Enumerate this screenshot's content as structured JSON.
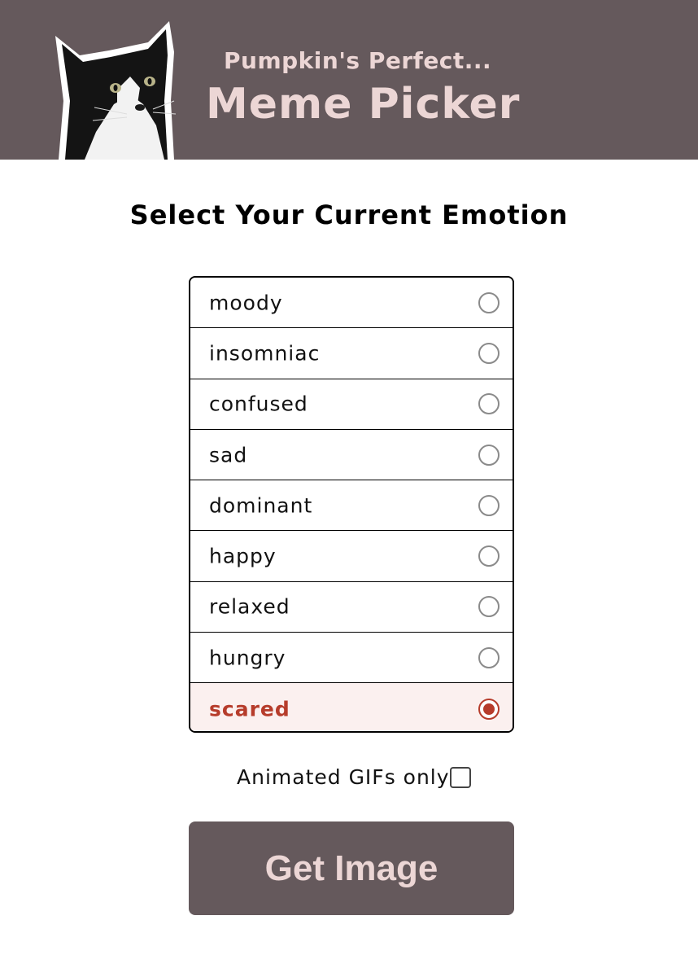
{
  "header": {
    "subtitle": "Pumpkin's Perfect...",
    "title": "Meme Picker",
    "logo_icon": "cat-photo-icon"
  },
  "heading": "Select Your Current Emotion",
  "emotions": [
    {
      "label": "moody",
      "selected": false
    },
    {
      "label": "insomniac",
      "selected": false
    },
    {
      "label": "confused",
      "selected": false
    },
    {
      "label": "sad",
      "selected": false
    },
    {
      "label": "dominant",
      "selected": false
    },
    {
      "label": "happy",
      "selected": false
    },
    {
      "label": "relaxed",
      "selected": false
    },
    {
      "label": "hungry",
      "selected": false
    },
    {
      "label": "scared",
      "selected": true
    }
  ],
  "gif_only": {
    "label": "Animated GIFs only",
    "checked": false
  },
  "button": {
    "label": "Get Image"
  },
  "colors": {
    "header_bg": "#65595c",
    "header_text": "#ecd6d5",
    "accent": "#b63c2b",
    "selected_bg": "#fbf0ef"
  }
}
